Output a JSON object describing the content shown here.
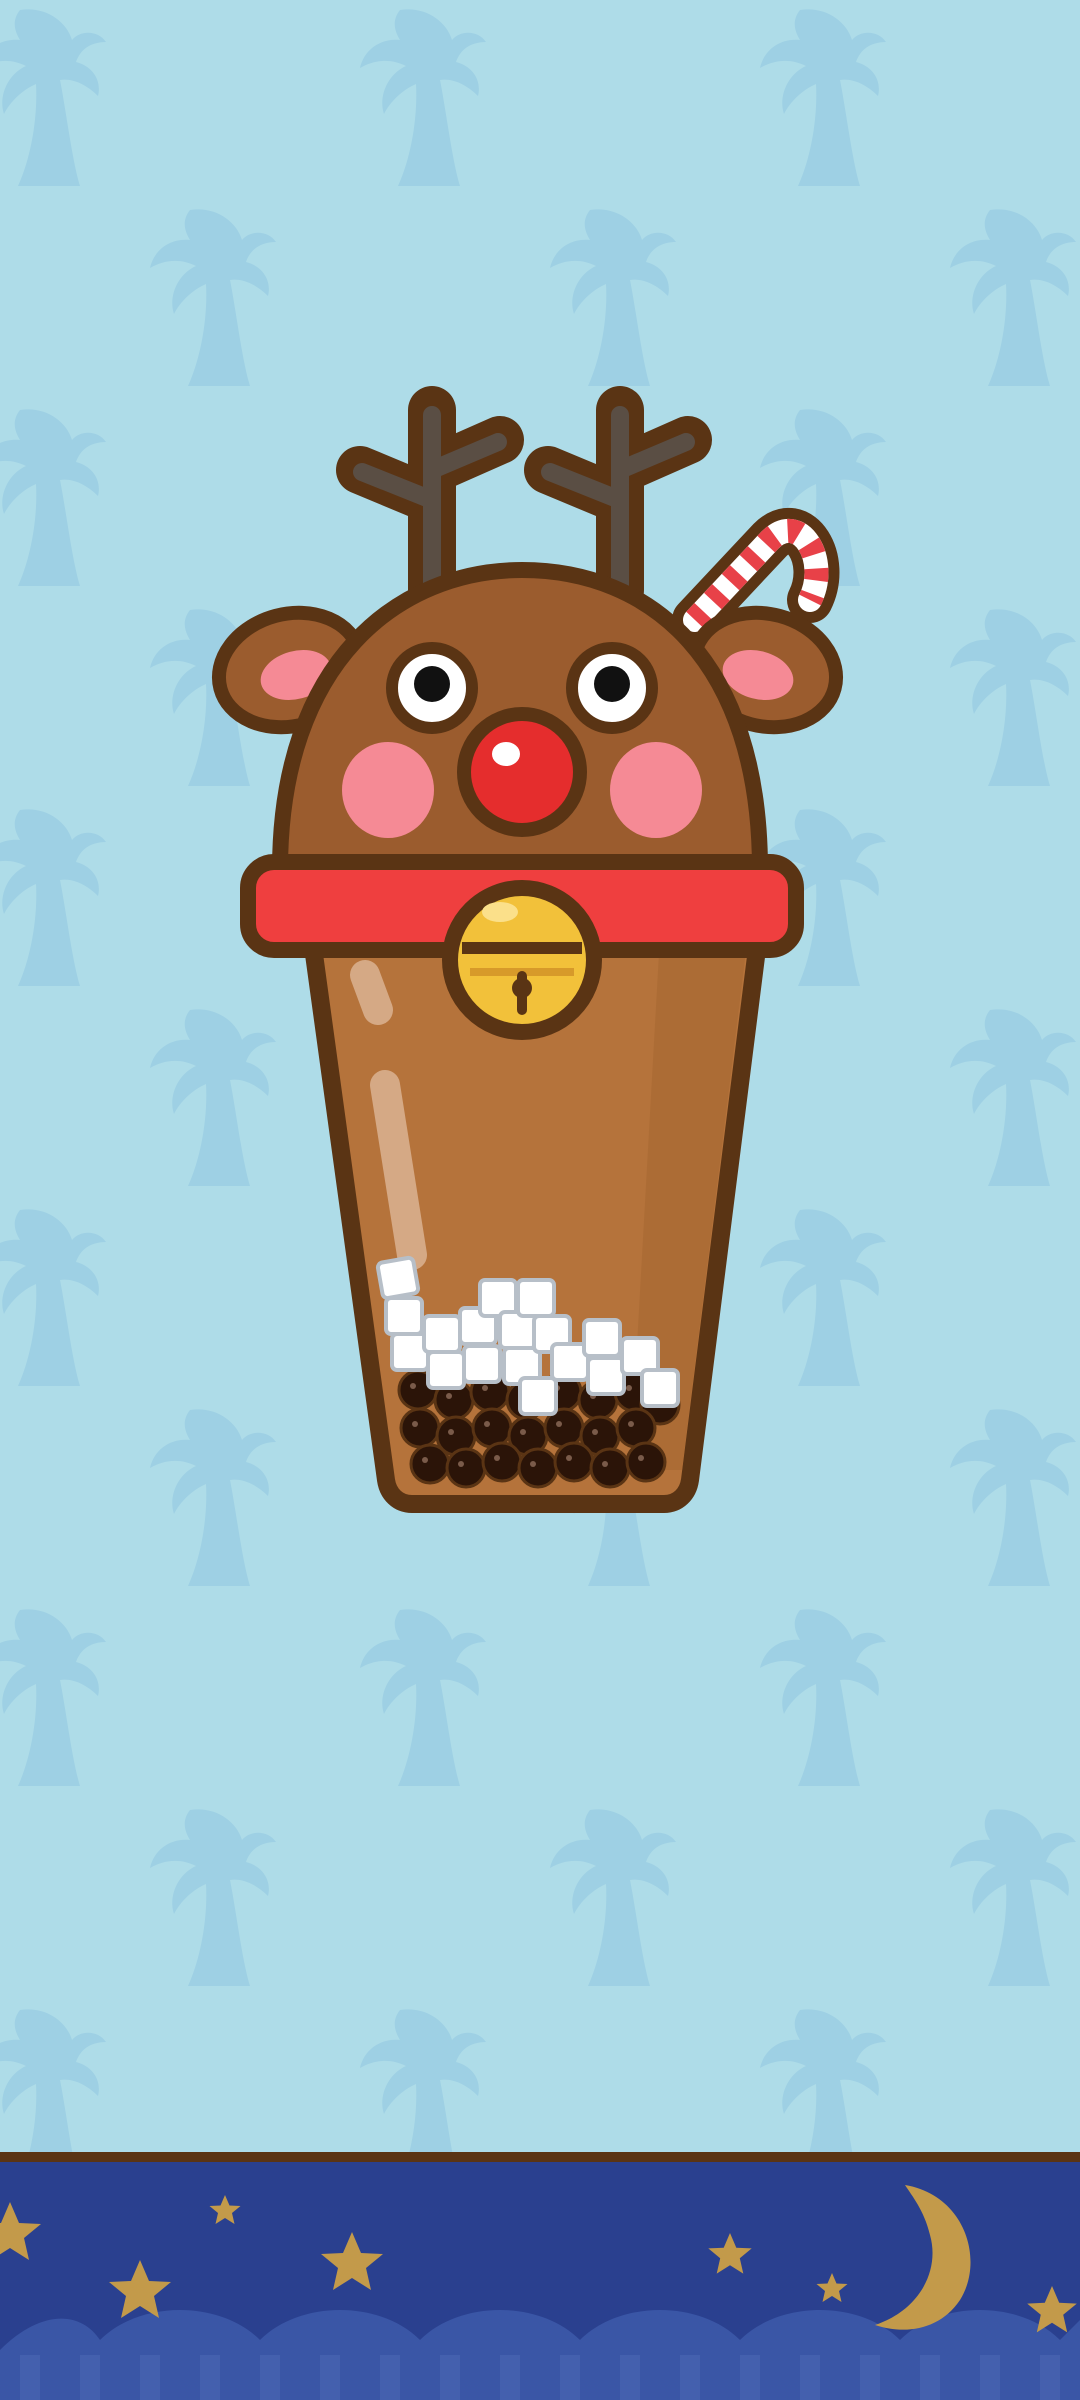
{
  "scene": {
    "name": "reindeer-bubble-tea-cup",
    "background_color": "#aedce8",
    "pattern_icon": "palm-tree-icon",
    "pattern_color": "#9ed0e4"
  },
  "cup": {
    "topper": "reindeer-head-icon",
    "accessories": [
      "antlers-icon",
      "candy-cane-icon",
      "red-nose-icon",
      "jingle-bell-icon",
      "red-collar-icon"
    ],
    "tea_color": "#b5733b",
    "outline_color": "#5a3414",
    "fill_contents": [
      "tapioca-pearls-icon",
      "ice-cubes-icon"
    ]
  },
  "footer": {
    "name": "night-sky-banner",
    "color": "#2a408f",
    "decorations": [
      "star-icon",
      "crescent-moon-icon"
    ],
    "accent_color": "#c39a4a"
  }
}
